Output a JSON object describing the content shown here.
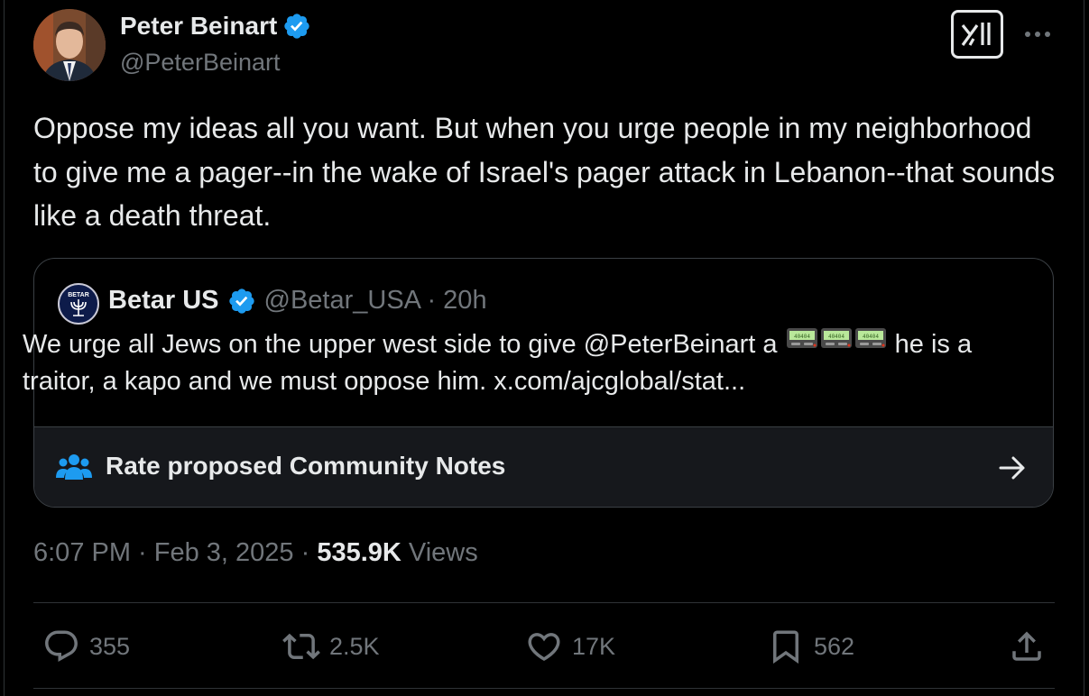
{
  "author": {
    "name": "Peter Beinart",
    "handle": "@PeterBeinart"
  },
  "tweet_text": "Oppose my ideas all you want. But when you urge people in my neighborhood to give me a pager--in the wake of Israel's pager attack in Lebanon--that sounds like a death threat.",
  "quoted": {
    "name": "Betar US",
    "handle_time": "@Betar_USA · 20h",
    "avatar_label": "BETAR",
    "text_before": "We urge all Jews on the upper west side to give @PeterBeinart a ",
    "pager_screen": "40404",
    "text_after": " he is a traitor, a kapo and we must oppose him. x.com/ajcglobal/stat...",
    "notes_label": "Rate proposed Community Notes"
  },
  "meta": {
    "time_date": "6:07 PM · Feb 3, 2025 · ",
    "views_count": "535.9K",
    "views_label": "Views"
  },
  "actions": {
    "replies": "355",
    "reposts": "2.5K",
    "likes": "17K",
    "bookmarks": "562"
  },
  "colors": {
    "background": "#000000",
    "text": "#e7e9ea",
    "secondary": "#71767b",
    "verified": "#1d9bf0",
    "notes_accent": "#1d9bf0"
  }
}
